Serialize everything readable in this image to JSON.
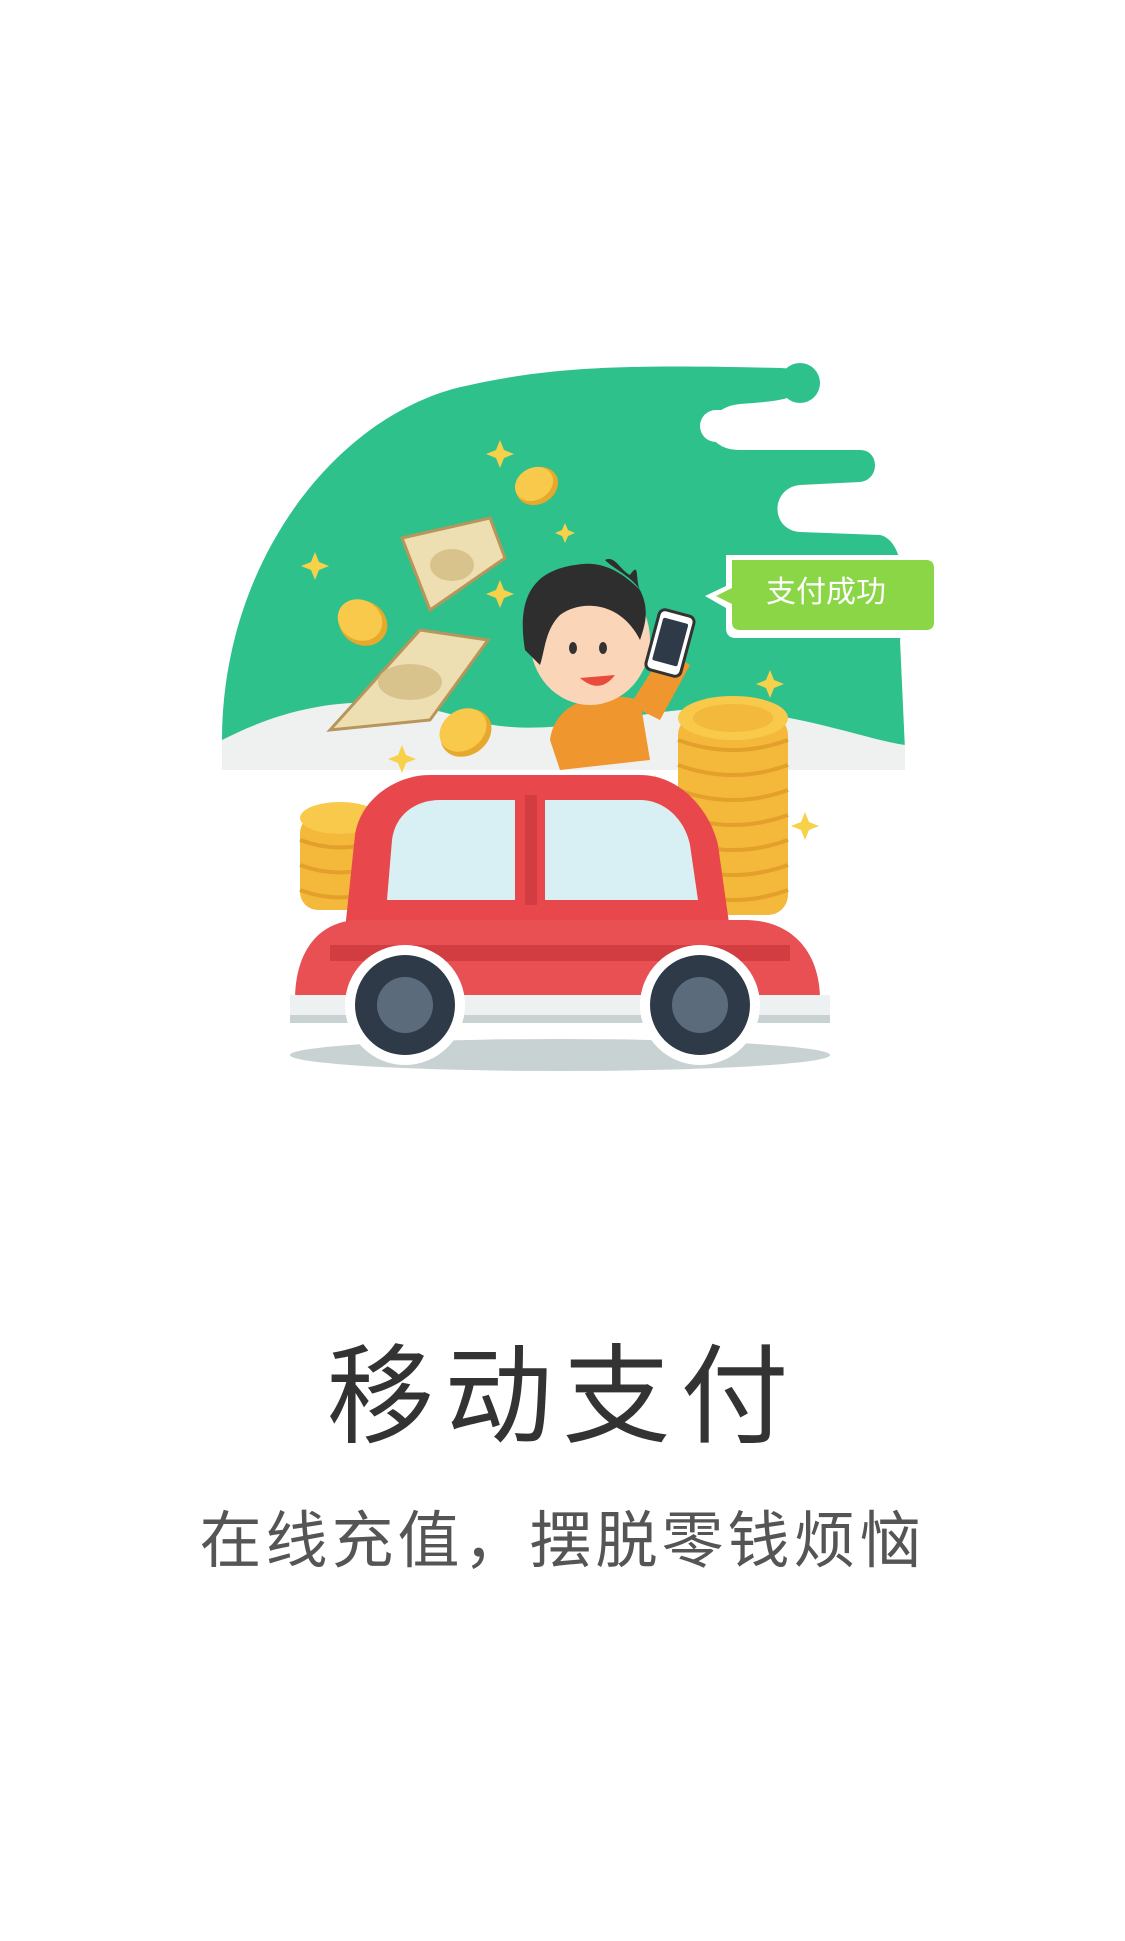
{
  "illustration": {
    "bubble_text": "支付成功",
    "colors": {
      "background_blob": "#2EC18C",
      "bubble": "#8BD646",
      "car_body": "#E8484B",
      "coin": "#F8C94A",
      "shirt": "#F0962E"
    }
  },
  "main": {
    "title": "移动支付",
    "subtitle": "在线充值，摆脱零钱烦恼"
  }
}
